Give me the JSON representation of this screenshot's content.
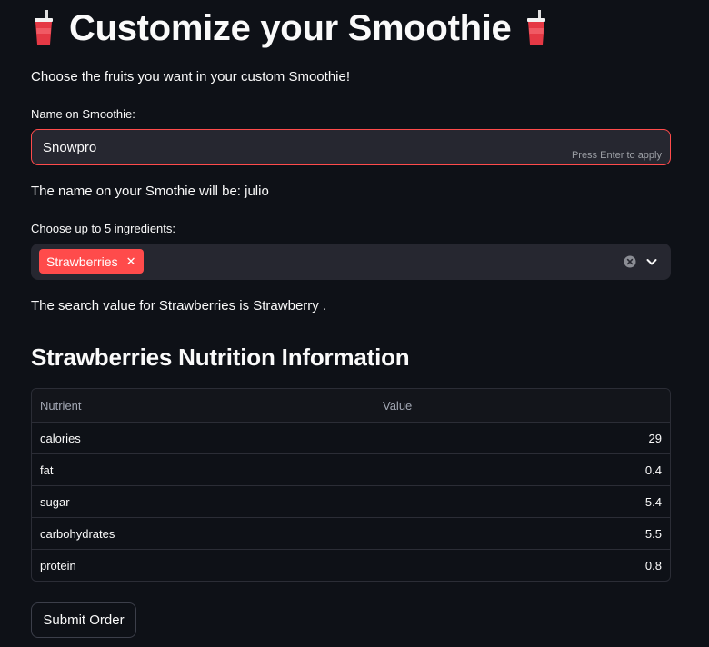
{
  "header": {
    "title": "Customize your Smoothie",
    "icon": "cup-with-straw-icon"
  },
  "intro": "Choose the fruits you want in your custom Smoothie!",
  "name_field": {
    "label": "Name on Smoothie:",
    "value": "Snowpro",
    "hint": "Press Enter to apply",
    "border_color": "#ff4b4b"
  },
  "name_output": "The name on your Smothie will be: julio",
  "ingredients": {
    "label": "Choose up to 5 ingredients:",
    "selected": [
      {
        "label": "Strawberries",
        "remove_icon": "close-icon"
      }
    ],
    "chip_color": "#ff4b4b"
  },
  "search_output": "The search value for Strawberries is Strawberry .",
  "nutrition": {
    "title": "Strawberries Nutrition Information",
    "columns": [
      "Nutrient",
      "Value"
    ],
    "rows": [
      {
        "nutrient": "calories",
        "value": "29"
      },
      {
        "nutrient": "fat",
        "value": "0.4"
      },
      {
        "nutrient": "sugar",
        "value": "5.4"
      },
      {
        "nutrient": "carbohydrates",
        "value": "5.5"
      },
      {
        "nutrient": "protein",
        "value": "0.8"
      }
    ]
  },
  "submit_label": "Submit Order",
  "colors": {
    "background": "#0e1117",
    "input_background": "#262730",
    "accent": "#ff4b4b"
  }
}
